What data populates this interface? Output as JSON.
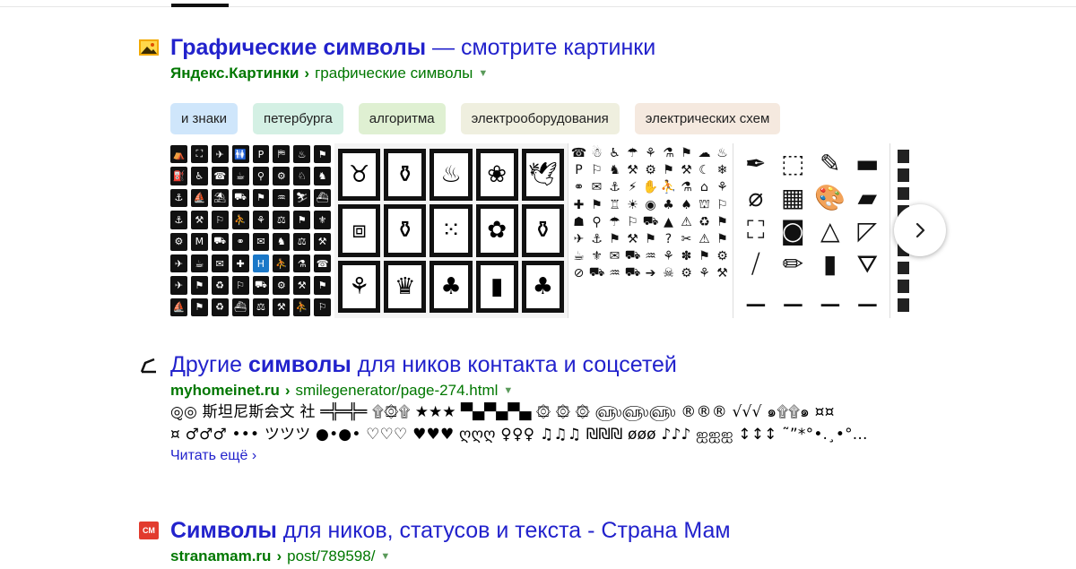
{
  "results": [
    {
      "title_bold": "Графические символы",
      "title_rest": " — смотрите картинки",
      "host": "Яндекс.Картинки",
      "path": "графические символы",
      "favicon": "image-icon"
    },
    {
      "title_pre": "Другие ",
      "title_bold": "символы",
      "title_rest": " для ников контакта и соцсетей",
      "host": "myhomeinet.ru",
      "path": "smilegenerator/page-274.html",
      "favicon": "pen-icon",
      "snippet_line1": "◎̮◎ 斯坦尼斯会文 社 ═╬═╬═ ۩۞۩ ★★★ ▀▄▀▄▀▄ ۞ ۞ ۞ ௵௵௵ ®®® √√√ ๑۩۩๑ ¤¤",
      "snippet_line2": "¤ ♂♂♂ ••• ツツツ ●•●• ♡♡♡ ♥♥♥ ღღღ ♀♀♀ ♫♫♫ ₪₪₪ øøø ♪♪♪ ஐஐஐ ↕↕↕ ˜”*°•.¸•°...",
      "read_more": "Читать ещё"
    },
    {
      "title_bold": "Символы",
      "title_rest": " для ников, статусов и текста - Страна Мам",
      "host": "stranamam.ru",
      "path": "post/789598/",
      "favicon_text": "СМ"
    }
  ],
  "chips": [
    {
      "label": "и знаки",
      "color": "#cfe6fb"
    },
    {
      "label": "петербурга",
      "color": "#d4f0e4"
    },
    {
      "label": "алгоритма",
      "color": "#dff0d2"
    },
    {
      "label": "электрооборудования",
      "color": "#efefdf"
    },
    {
      "label": "электрических схем",
      "color": "#f5e9df"
    }
  ],
  "gallery": {
    "next_icon": "chevron-right-icon"
  }
}
